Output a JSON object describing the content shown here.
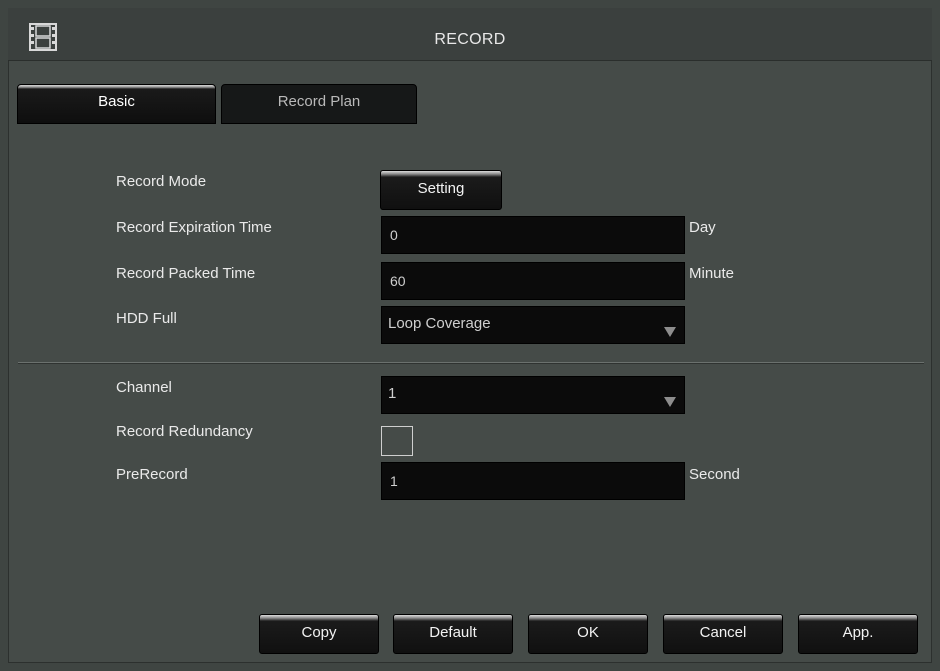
{
  "window": {
    "title": "RECORD",
    "icon": "film-icon"
  },
  "tabs": [
    {
      "label": "Basic",
      "active": true
    },
    {
      "label": "Record Plan",
      "active": false
    }
  ],
  "basic": {
    "record_mode": {
      "label": "Record Mode",
      "button": "Setting"
    },
    "expiration": {
      "label": "Record Expiration Time",
      "value": "0",
      "unit": "Day"
    },
    "packed": {
      "label": "Record Packed Time",
      "value": "60",
      "unit": "Minute"
    },
    "hdd_full": {
      "label": "HDD Full",
      "value": "Loop Coverage"
    },
    "channel": {
      "label": "Channel",
      "value": "1"
    },
    "redundancy": {
      "label": "Record Redundancy",
      "checked": false
    },
    "prerecord": {
      "label": "PreRecord",
      "value": "1",
      "unit": "Second"
    }
  },
  "buttons": {
    "copy": "Copy",
    "default": "Default",
    "ok": "OK",
    "cancel": "Cancel",
    "apply": "App."
  }
}
